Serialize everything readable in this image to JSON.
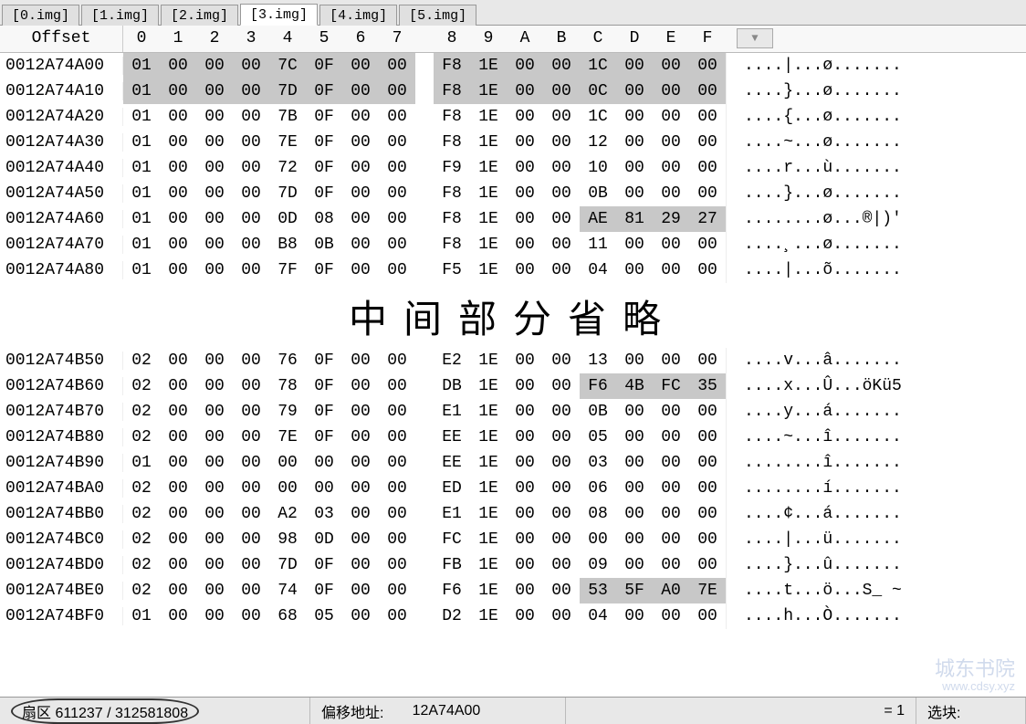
{
  "tabs": [
    "[0.img]",
    "[1.img]",
    "[2.img]",
    "[3.img]",
    "[4.img]",
    "[5.img]"
  ],
  "active_tab": 3,
  "offset_label": "Offset",
  "hex_cols": [
    "0",
    "1",
    "2",
    "3",
    "4",
    "5",
    "6",
    "7",
    "8",
    "9",
    "A",
    "B",
    "C",
    "D",
    "E",
    "F"
  ],
  "rows_top": [
    {
      "offset": "0012A74A00",
      "hex": [
        "01",
        "00",
        "00",
        "00",
        "7C",
        "0F",
        "00",
        "00",
        "F8",
        "1E",
        "00",
        "00",
        "1C",
        "00",
        "00",
        "00"
      ],
      "ascii": "....|...ø.......",
      "hl": [
        0,
        1,
        2,
        3,
        4,
        5,
        6,
        7,
        8,
        9,
        10,
        11,
        12,
        13,
        14,
        15
      ]
    },
    {
      "offset": "0012A74A10",
      "hex": [
        "01",
        "00",
        "00",
        "00",
        "7D",
        "0F",
        "00",
        "00",
        "F8",
        "1E",
        "00",
        "00",
        "0C",
        "00",
        "00",
        "00"
      ],
      "ascii": "....}...ø.......",
      "hl": [
        0,
        1,
        2,
        3,
        4,
        5,
        6,
        7,
        8,
        9,
        10,
        11,
        12,
        13,
        14,
        15
      ]
    },
    {
      "offset": "0012A74A20",
      "hex": [
        "01",
        "00",
        "00",
        "00",
        "7B",
        "0F",
        "00",
        "00",
        "F8",
        "1E",
        "00",
        "00",
        "1C",
        "00",
        "00",
        "00"
      ],
      "ascii": "....{...ø.......",
      "hl": []
    },
    {
      "offset": "0012A74A30",
      "hex": [
        "01",
        "00",
        "00",
        "00",
        "7E",
        "0F",
        "00",
        "00",
        "F8",
        "1E",
        "00",
        "00",
        "12",
        "00",
        "00",
        "00"
      ],
      "ascii": "....~...ø.......",
      "hl": []
    },
    {
      "offset": "0012A74A40",
      "hex": [
        "01",
        "00",
        "00",
        "00",
        "72",
        "0F",
        "00",
        "00",
        "F9",
        "1E",
        "00",
        "00",
        "10",
        "00",
        "00",
        "00"
      ],
      "ascii": "....r...ù.......",
      "hl": []
    },
    {
      "offset": "0012A74A50",
      "hex": [
        "01",
        "00",
        "00",
        "00",
        "7D",
        "0F",
        "00",
        "00",
        "F8",
        "1E",
        "00",
        "00",
        "0B",
        "00",
        "00",
        "00"
      ],
      "ascii": "....}...ø.......",
      "hl": []
    },
    {
      "offset": "0012A74A60",
      "hex": [
        "01",
        "00",
        "00",
        "00",
        "0D",
        "08",
        "00",
        "00",
        "F8",
        "1E",
        "00",
        "00",
        "AE",
        "81",
        "29",
        "27"
      ],
      "ascii": "........ø...®|)'",
      "hl": [
        12,
        13,
        14,
        15
      ]
    },
    {
      "offset": "0012A74A70",
      "hex": [
        "01",
        "00",
        "00",
        "00",
        "B8",
        "0B",
        "00",
        "00",
        "F8",
        "1E",
        "00",
        "00",
        "11",
        "00",
        "00",
        "00"
      ],
      "ascii": "....¸...ø.......",
      "hl": []
    },
    {
      "offset": "0012A74A80",
      "hex": [
        "01",
        "00",
        "00",
        "00",
        "7F",
        "0F",
        "00",
        "00",
        "F5",
        "1E",
        "00",
        "00",
        "04",
        "00",
        "00",
        "00"
      ],
      "ascii": "....|...õ.......",
      "hl": []
    }
  ],
  "omit_text": "中间部分省略",
  "rows_bottom": [
    {
      "offset": "0012A74B50",
      "hex": [
        "02",
        "00",
        "00",
        "00",
        "76",
        "0F",
        "00",
        "00",
        "E2",
        "1E",
        "00",
        "00",
        "13",
        "00",
        "00",
        "00"
      ],
      "ascii": "....v...â.......",
      "hl": []
    },
    {
      "offset": "0012A74B60",
      "hex": [
        "02",
        "00",
        "00",
        "00",
        "78",
        "0F",
        "00",
        "00",
        "DB",
        "1E",
        "00",
        "00",
        "F6",
        "4B",
        "FC",
        "35"
      ],
      "ascii": "....x...Û...öKü5",
      "hl": [
        12,
        13,
        14,
        15
      ]
    },
    {
      "offset": "0012A74B70",
      "hex": [
        "02",
        "00",
        "00",
        "00",
        "79",
        "0F",
        "00",
        "00",
        "E1",
        "1E",
        "00",
        "00",
        "0B",
        "00",
        "00",
        "00"
      ],
      "ascii": "....y...á.......",
      "hl": []
    },
    {
      "offset": "0012A74B80",
      "hex": [
        "02",
        "00",
        "00",
        "00",
        "7E",
        "0F",
        "00",
        "00",
        "EE",
        "1E",
        "00",
        "00",
        "05",
        "00",
        "00",
        "00"
      ],
      "ascii": "....~...î.......",
      "hl": []
    },
    {
      "offset": "0012A74B90",
      "hex": [
        "01",
        "00",
        "00",
        "00",
        "00",
        "00",
        "00",
        "00",
        "EE",
        "1E",
        "00",
        "00",
        "03",
        "00",
        "00",
        "00"
      ],
      "ascii": "........î.......",
      "hl": []
    },
    {
      "offset": "0012A74BA0",
      "hex": [
        "02",
        "00",
        "00",
        "00",
        "00",
        "00",
        "00",
        "00",
        "ED",
        "1E",
        "00",
        "00",
        "06",
        "00",
        "00",
        "00"
      ],
      "ascii": "........í.......",
      "hl": []
    },
    {
      "offset": "0012A74BB0",
      "hex": [
        "02",
        "00",
        "00",
        "00",
        "A2",
        "03",
        "00",
        "00",
        "E1",
        "1E",
        "00",
        "00",
        "08",
        "00",
        "00",
        "00"
      ],
      "ascii": "....¢...á.......",
      "hl": []
    },
    {
      "offset": "0012A74BC0",
      "hex": [
        "02",
        "00",
        "00",
        "00",
        "98",
        "0D",
        "00",
        "00",
        "FC",
        "1E",
        "00",
        "00",
        "00",
        "00",
        "00",
        "00"
      ],
      "ascii": "....|...ü.......",
      "hl": []
    },
    {
      "offset": "0012A74BD0",
      "hex": [
        "02",
        "00",
        "00",
        "00",
        "7D",
        "0F",
        "00",
        "00",
        "FB",
        "1E",
        "00",
        "00",
        "09",
        "00",
        "00",
        "00"
      ],
      "ascii": "....}...û.......",
      "hl": []
    },
    {
      "offset": "0012A74BE0",
      "hex": [
        "02",
        "00",
        "00",
        "00",
        "74",
        "0F",
        "00",
        "00",
        "F6",
        "1E",
        "00",
        "00",
        "53",
        "5F",
        "A0",
        "7E"
      ],
      "ascii": "....t...ö...S_ ~",
      "hl": [
        12,
        13,
        14,
        15
      ]
    },
    {
      "offset": "0012A74BF0",
      "hex": [
        "01",
        "00",
        "00",
        "00",
        "68",
        "05",
        "00",
        "00",
        "D2",
        "1E",
        "00",
        "00",
        "04",
        "00",
        "00",
        "00"
      ],
      "ascii": "....h...Ò.......",
      "hl": []
    }
  ],
  "status": {
    "sector_label": "扇区",
    "sector_value": "611237 / 312581808",
    "offset_label": "偏移地址:",
    "offset_value": "12A74A00",
    "eq": "= 1",
    "sel_label": "选块:"
  },
  "watermark": {
    "l1": "城东书院",
    "l2": "www.cdsy.xyz"
  }
}
